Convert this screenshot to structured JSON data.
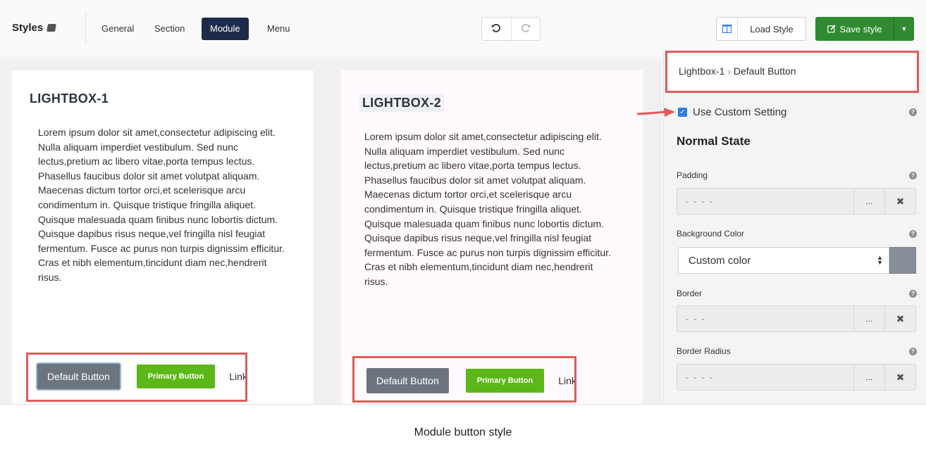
{
  "toolbar": {
    "brand": "Styles",
    "tabs": [
      {
        "label": "General",
        "active": false
      },
      {
        "label": "Section",
        "active": false
      },
      {
        "label": "Module",
        "active": true
      },
      {
        "label": "Menu",
        "active": false
      }
    ],
    "undo_icon": "undo-icon",
    "redo_icon": "redo-icon",
    "load_style": "Load Style",
    "save_style": "Save style"
  },
  "cards": [
    {
      "title": "LIGHTBOX-1",
      "body": "Lorem ipsum dolor sit amet,consectetur adipiscing elit. Nulla aliquam imperdiet vestibulum. Sed nunc lectus,pretium ac libero vitae,porta tempus lectus. Phasellus faucibus dolor sit amet volutpat aliquam. Maecenas dictum tortor orci,et scelerisque arcu condimentum in. Quisque tristique fringilla aliquet. Quisque malesuada quam finibus nunc lobortis dictum. Quisque dapibus risus neque,vel fringilla nisl feugiat fermentum. Fusce ac purus non turpis dignissim efficitur. Cras et nibh elementum,tincidunt diam nec,hendrerit risus.",
      "default_button": "Default Button",
      "primary_button": "Primary Button",
      "link": "Link"
    },
    {
      "title": "LIGHTBOX-2",
      "body": "Lorem ipsum dolor sit amet,consectetur adipiscing elit. Nulla aliquam imperdiet vestibulum. Sed nunc lectus,pretium ac libero vitae,porta tempus lectus. Phasellus faucibus dolor sit amet volutpat aliquam. Maecenas dictum tortor orci,et scelerisque arcu condimentum in. Quisque tristique fringilla aliquet. Quisque malesuada quam finibus nunc lobortis dictum. Quisque dapibus risus neque,vel fringilla nisl feugiat fermentum. Fusce ac purus non turpis dignissim efficitur. Cras et nibh elementum,tincidunt diam nec,hendrerit risus.",
      "default_button": "Default Button",
      "primary_button": "Primary Button",
      "link": "Link"
    }
  ],
  "panel": {
    "breadcrumb_parent": "Lightbox-1",
    "breadcrumb_separator": "›",
    "breadcrumb_child": "Default Button",
    "use_custom": {
      "label": "Use Custom Setting",
      "checked": true
    },
    "section_title": "Normal State",
    "padding": {
      "label": "Padding",
      "value": "- - - -"
    },
    "background": {
      "label": "Background Color",
      "value": "Custom color",
      "swatch_color": "#888e99"
    },
    "border": {
      "label": "Border",
      "value": "- - -"
    },
    "border_radius": {
      "label": "Border Radius",
      "value": "- - - -"
    },
    "more_label": "...",
    "clear_label": "✖",
    "help_label": "?"
  },
  "colors": {
    "highlight": "#e05b5b",
    "save_green": "#2f8a30",
    "active_tab": "#1d2b4a",
    "primary_button": "#5cb818",
    "default_button": "#6c757e"
  },
  "caption": "Module button style"
}
